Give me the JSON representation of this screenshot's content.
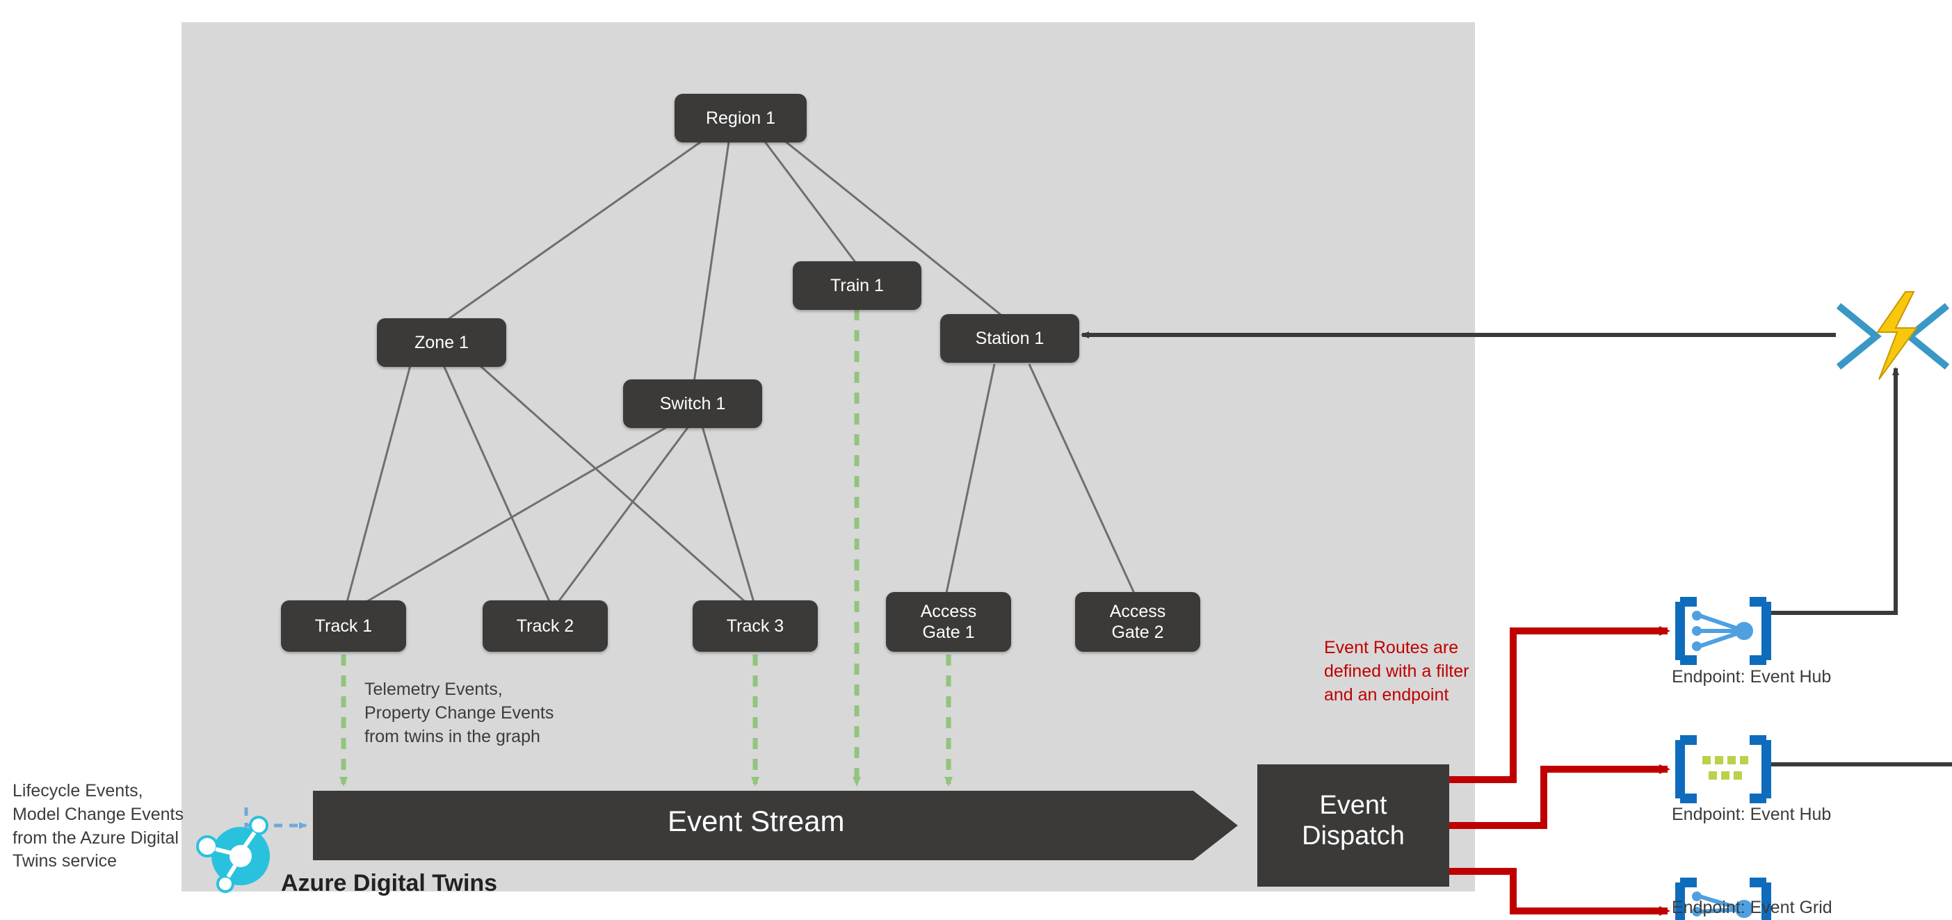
{
  "nodes": {
    "region1": "Region 1",
    "zone1": "Zone 1",
    "train1": "Train 1",
    "station1": "Station 1",
    "switch1": "Switch 1",
    "track1": "Track 1",
    "track2": "Track 2",
    "track3": "Track 3",
    "accessGate1_line1": "Access",
    "accessGate1_line2": "Gate 1",
    "accessGate2_line1": "Access",
    "accessGate2_line2": "Gate 2"
  },
  "stream": {
    "eventStream": "Event Stream",
    "eventDispatch_line1": "Event",
    "eventDispatch_line2": "Dispatch"
  },
  "annotations": {
    "telemetry_line1": "Telemetry Events,",
    "telemetry_line2": "Property Change Events",
    "telemetry_line3": "from twins in the graph",
    "lifecycle_line1": "Lifecycle Events,",
    "lifecycle_line2": "Model Change Events",
    "lifecycle_line3": "from the Azure Digital",
    "lifecycle_line4": "Twins service",
    "eventRoutes_line1": "Event Routes are",
    "eventRoutes_line2": "defined with a filter",
    "eventRoutes_line3": "and an endpoint"
  },
  "branding": {
    "adtTitle": "Azure Digital Twins"
  },
  "endpoints": {
    "top": "Endpoint: Event Hub",
    "middle": "Endpoint: Event Hub",
    "bottom": "Endpoint: Event Grid"
  }
}
